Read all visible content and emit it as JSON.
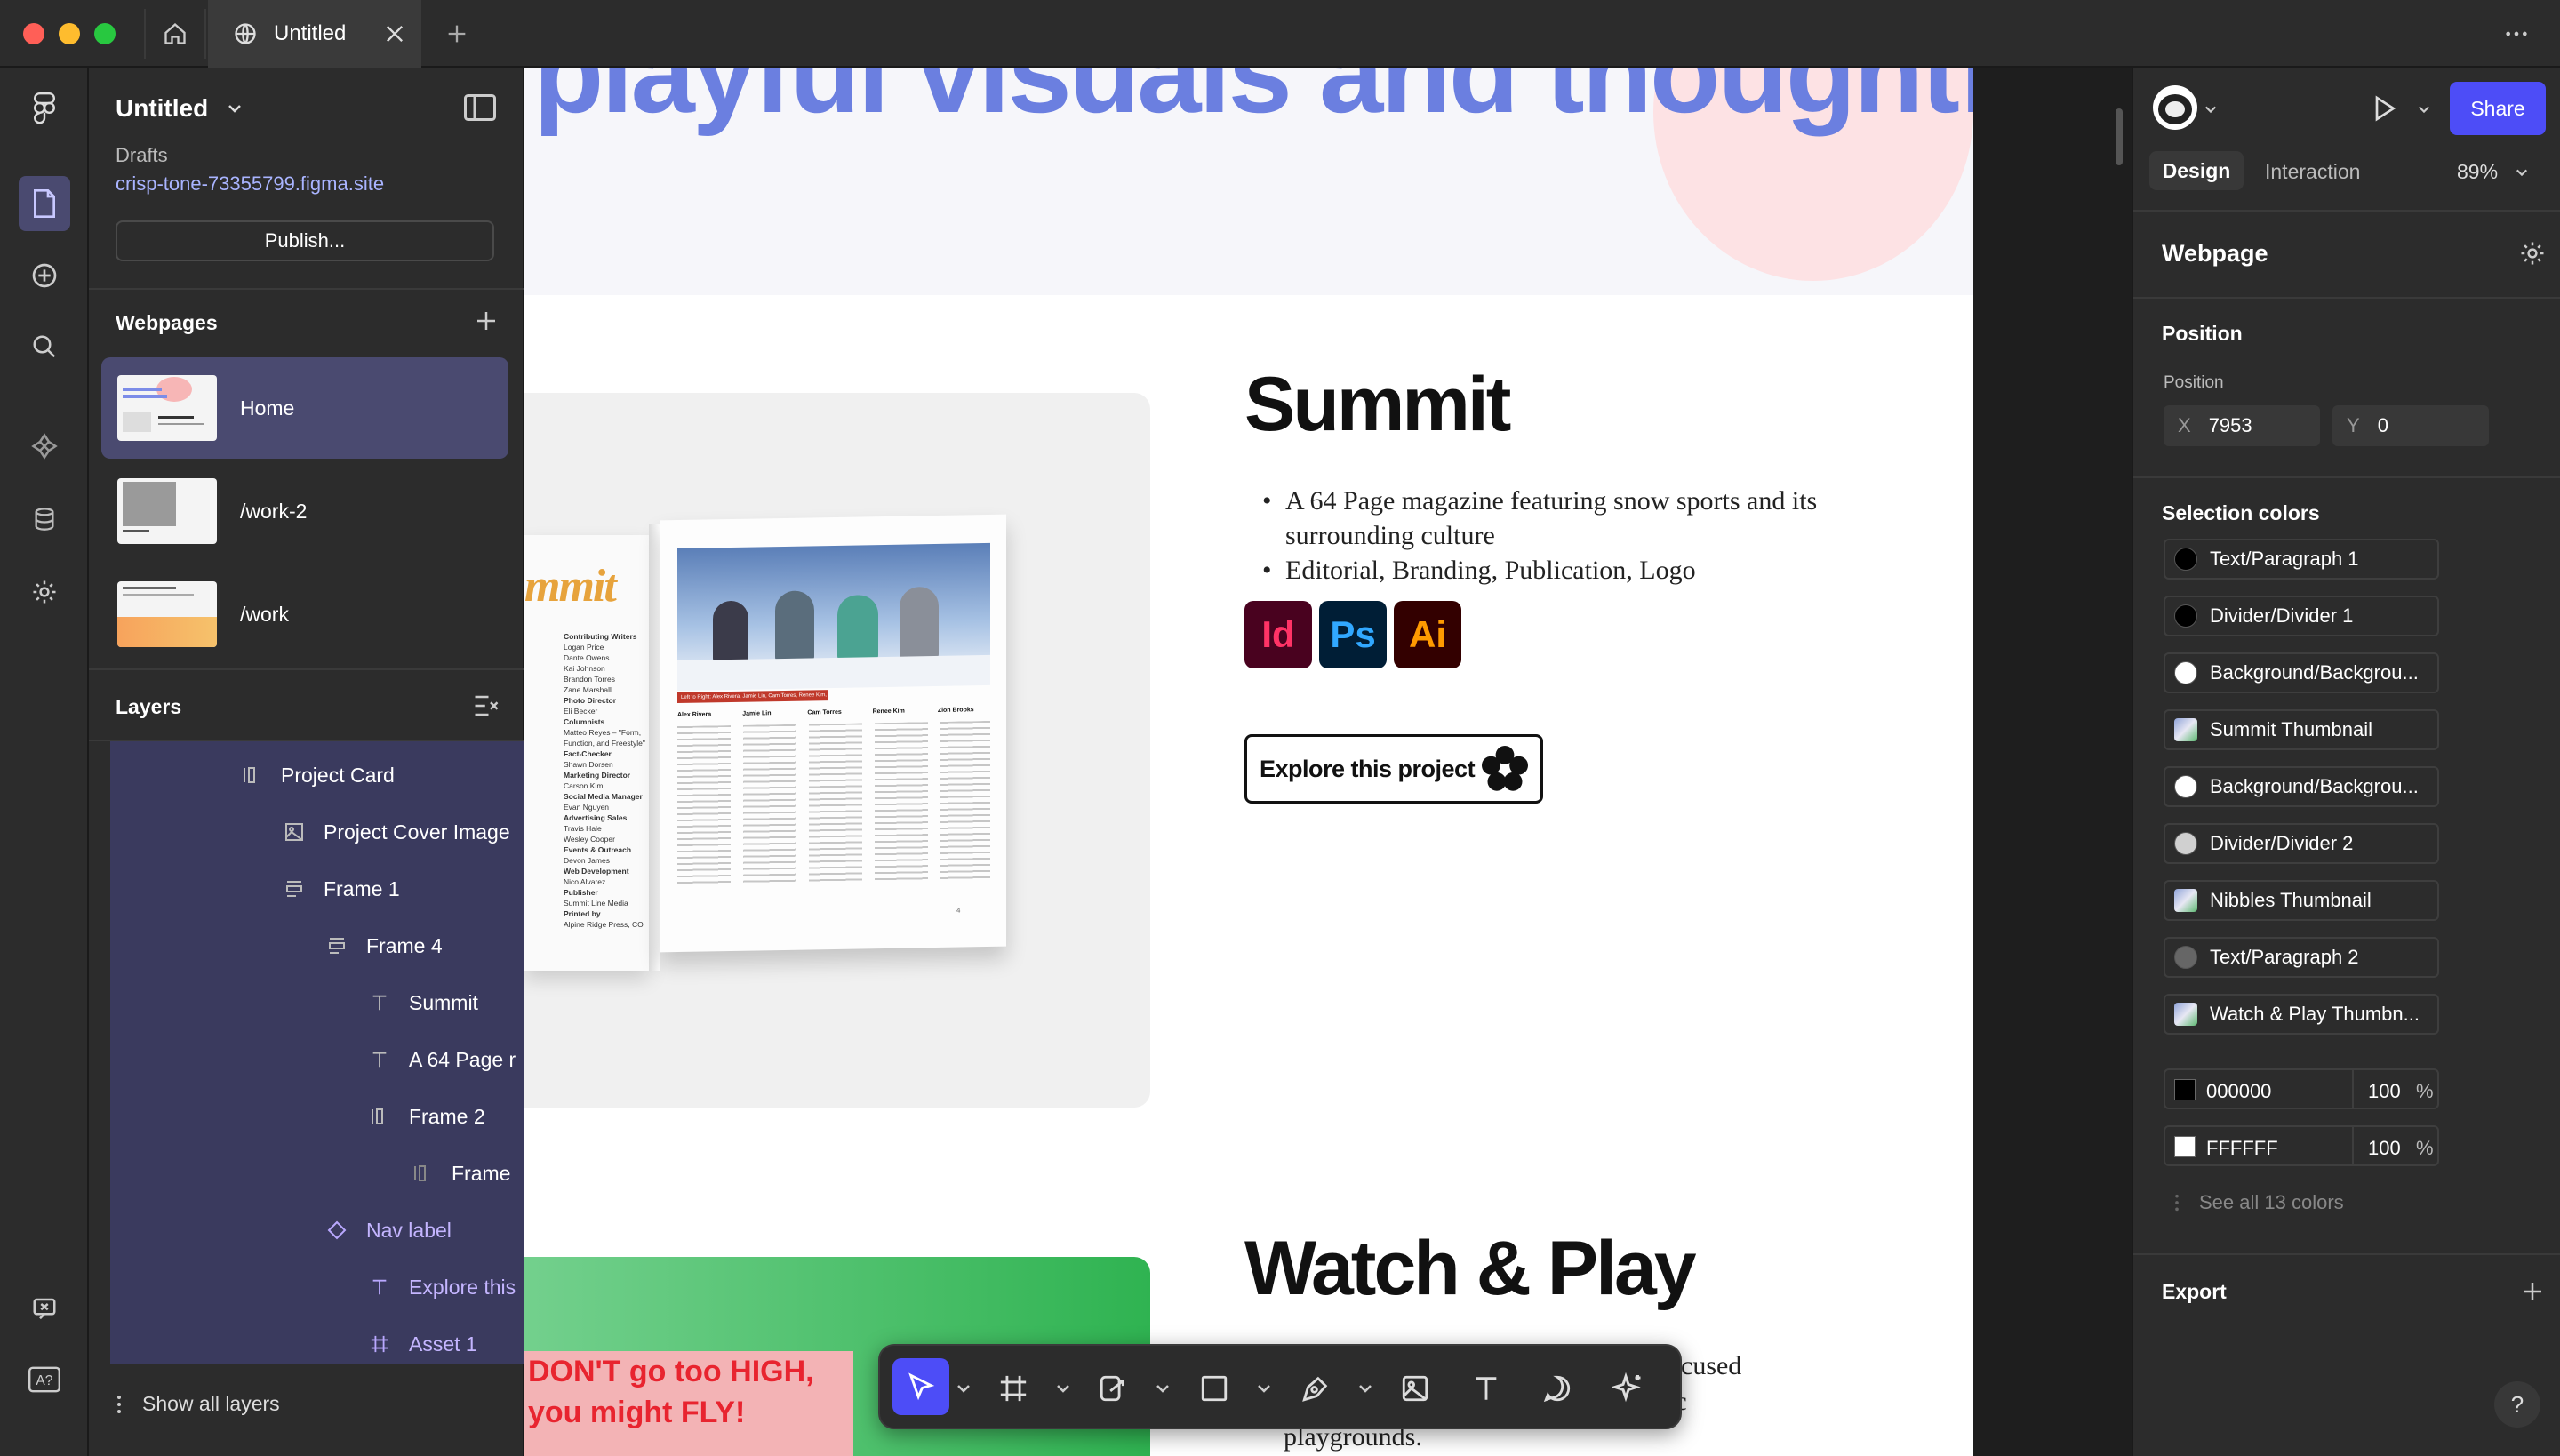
{
  "browser": {
    "tab_title": "Untitled",
    "icons": [
      "home-icon",
      "globe-icon",
      "close-icon",
      "plus-icon",
      "more-icon"
    ]
  },
  "left_panel": {
    "file_title": "Untitled",
    "location": "Drafts",
    "site_url": "crisp-tone-73355799.figma.site",
    "publish_label": "Publish...",
    "webpages_heading": "Webpages",
    "pages": [
      {
        "label": "Home"
      },
      {
        "label": "/work-2"
      },
      {
        "label": "/work"
      }
    ],
    "layers_heading": "Layers",
    "layers": [
      {
        "label": "Project Card",
        "icon": "auto-layout-horizontal-icon"
      },
      {
        "label": "Project Cover Image",
        "icon": "image-icon"
      },
      {
        "label": "Frame 1",
        "icon": "auto-layout-vertical-icon"
      },
      {
        "label": "Frame 4",
        "icon": "auto-layout-vertical-icon"
      },
      {
        "label": "Summit",
        "icon": "text-icon"
      },
      {
        "label": "A 64 Page r",
        "icon": "text-icon"
      },
      {
        "label": "Frame 2",
        "icon": "auto-layout-horizontal-icon"
      },
      {
        "label": "Frame",
        "icon": "auto-layout-horizontal-icon"
      },
      {
        "label": "Nav label",
        "icon": "component-icon"
      },
      {
        "label": "Explore this",
        "icon": "text-icon"
      },
      {
        "label": "Asset 1",
        "icon": "frame-icon"
      }
    ],
    "show_all_layers": "Show all layers"
  },
  "canvas": {
    "hero_text": "playful visuals and thoughtful",
    "projects": [
      {
        "title": "Summit",
        "bullets": [
          "A 64 Page magazine featuring snow sports and its surrounding culture",
          "Editorial, Branding, Publication, Logo"
        ],
        "tools": [
          "Id",
          "Ps",
          "Ai"
        ],
        "cta": "Explore this project"
      },
      {
        "title": "Watch & Play",
        "bullets_partial": [
          "ocused",
          "ic",
          "playgrounds."
        ]
      }
    ],
    "magazine": {
      "masthead": "mmit",
      "credits_left": [
        "Contributing Writers",
        "Logan Price",
        "Dante Owens",
        "Kai Johnson",
        "Brandon Torres",
        "Zane Marshall",
        "Photo Director",
        "Eli Becker",
        "Columnists",
        "Matteo Reyes – \"Form, Function, and Freestyle\"",
        "Fact-Checker",
        "Shawn Dorsen",
        "Marketing Director",
        "Carson Kim",
        "Social Media Manager",
        "Evan Nguyen",
        "Advertising Sales",
        "Travis Hale",
        "Wesley Cooper",
        "Events & Outreach",
        "Devon James",
        "Web Development",
        "Nico Alvarez",
        "Publisher",
        "Summit Line Media",
        "Printed by",
        "Alpine Ridge Press, CO"
      ],
      "caption": "Left to Right: Alex Rivera, Jamie Lin, Cam Torres, Renee Kim, Zion Brooks",
      "col_heads": [
        "Alex Rivera",
        "Jamie Lin",
        "Cam Torres",
        "Renee Kim",
        "Zion Brooks"
      ],
      "page_number": "4"
    },
    "card2_text": [
      "DON'T go too HIGH,",
      "you might FLY!"
    ]
  },
  "right_panel": {
    "zoom": "89%",
    "share_label": "Share",
    "tabs": [
      "Design",
      "Interaction"
    ],
    "selection_type": "Webpage",
    "position_heading": "Position",
    "position_label": "Position",
    "x_label": "X",
    "x_value": "7953",
    "y_label": "Y",
    "y_value": "0",
    "selection_colors_heading": "Selection colors",
    "colors": [
      {
        "label": "Text/Paragraph 1",
        "swatch": "#000000"
      },
      {
        "label": "Divider/Divider 1",
        "swatch": "#000000"
      },
      {
        "label": "Background/Backgrou...",
        "swatch": "#ffffff"
      },
      {
        "label": "Summit Thumbnail",
        "swatch": "image"
      },
      {
        "label": "Background/Backgrou...",
        "swatch": "#ffffff"
      },
      {
        "label": "Divider/Divider 2",
        "swatch": "#d0d0d0"
      },
      {
        "label": "Nibbles Thumbnail",
        "swatch": "image"
      },
      {
        "label": "Text/Paragraph 2",
        "swatch": "#666666"
      },
      {
        "label": "Watch & Play Thumbn...",
        "swatch": "image"
      }
    ],
    "hex_colors": [
      {
        "hex": "000000",
        "opacity": "100",
        "unit": "%"
      },
      {
        "hex": "FFFFFF",
        "opacity": "100",
        "unit": "%"
      }
    ],
    "see_all": "See all 13 colors",
    "export_heading": "Export"
  },
  "toolbar": {
    "tools": [
      "move-tool",
      "frame-tool",
      "shape-tool",
      "rectangle-tool",
      "pen-tool",
      "image-tool",
      "text-tool",
      "comment-tool",
      "ai-tool"
    ]
  },
  "help_label": "?",
  "colors": {
    "accent": "#4d4df7",
    "link": "#a9b4ff",
    "layer_selection": "#3a3a5e",
    "page_selected": "#4a4a70"
  }
}
